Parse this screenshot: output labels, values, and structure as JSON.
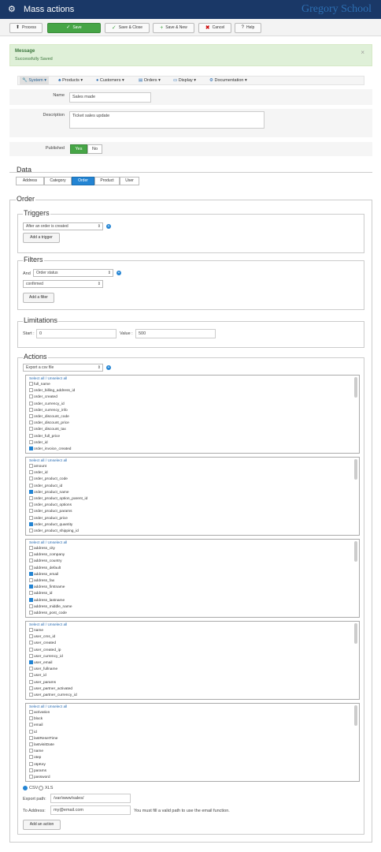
{
  "header": {
    "title": "Mass actions",
    "brand": "Gregory School",
    "gear_icon": "⚙"
  },
  "toolbar": [
    {
      "name": "process-button",
      "icon": "⬆",
      "label": "Process"
    },
    {
      "name": "save-button",
      "icon": "✓",
      "label": "Save"
    },
    {
      "name": "save-close-button",
      "icon": "✓",
      "label": "Save & Close"
    },
    {
      "name": "save-new-button",
      "icon": "+",
      "label": "Save & New"
    },
    {
      "name": "cancel-button",
      "icon": "✖",
      "label": "Cancel"
    },
    {
      "name": "help-button",
      "icon": "?",
      "label": "Help"
    }
  ],
  "message": {
    "heading": "Message",
    "text": "Successfully Saved",
    "close": "×"
  },
  "nav": [
    {
      "label": "System ▾"
    },
    {
      "label": "Products ▾"
    },
    {
      "label": "Customers ▾"
    },
    {
      "label": "Orders ▾"
    },
    {
      "label": "Display ▾"
    },
    {
      "label": "Documentation ▾"
    }
  ],
  "form": {
    "name_label": "Name",
    "name_value": "Sales made",
    "description_label": "Description",
    "description_value": "Ticket sales update",
    "published_label": "Published",
    "yes": "Yes",
    "no": "No"
  },
  "data_section": {
    "title": "Data",
    "tabs": [
      "Address",
      "Category",
      "Order",
      "Product",
      "User"
    ],
    "selected": "Order"
  },
  "order_section": {
    "title": "Order"
  },
  "triggers": {
    "title": "Triggers",
    "select": "After an order is created",
    "add": "Add a trigger"
  },
  "filters": {
    "title": "Filters",
    "and": "And",
    "select": "Order status",
    "value": "confirmed",
    "add": "Add a filter"
  },
  "limitations": {
    "title": "Limitations",
    "start_label": "Start :",
    "start": "0",
    "value_label": "Value :",
    "value": "500"
  },
  "actions": {
    "title": "Actions",
    "select": "Export a csv file",
    "select_all": "Select all / Unselect all",
    "lists": [
      {
        "items": [
          {
            "label": "full_name",
            "checked": false
          },
          {
            "label": "order_billing_address_id",
            "checked": false
          },
          {
            "label": "order_created",
            "checked": false
          },
          {
            "label": "order_currency_id",
            "checked": false
          },
          {
            "label": "order_currency_info",
            "checked": false
          },
          {
            "label": "order_discount_code",
            "checked": false
          },
          {
            "label": "order_discount_price",
            "checked": false
          },
          {
            "label": "order_discount_tax",
            "checked": false
          },
          {
            "label": "order_full_price",
            "checked": false
          },
          {
            "label": "order_id",
            "checked": false
          },
          {
            "label": "order_invoice_created",
            "checked": true
          }
        ]
      },
      {
        "items": [
          {
            "label": "amount",
            "checked": false
          },
          {
            "label": "order_id",
            "checked": false
          },
          {
            "label": "order_product_code",
            "checked": false
          },
          {
            "label": "order_product_id",
            "checked": false
          },
          {
            "label": "order_product_name",
            "checked": true
          },
          {
            "label": "order_product_option_parent_id",
            "checked": false
          },
          {
            "label": "order_product_options",
            "checked": false
          },
          {
            "label": "order_product_params",
            "checked": false
          },
          {
            "label": "order_product_price",
            "checked": false
          },
          {
            "label": "order_product_quantity",
            "checked": true
          },
          {
            "label": "order_product_shipping_id",
            "checked": false
          }
        ]
      },
      {
        "items": [
          {
            "label": "address_city",
            "checked": false
          },
          {
            "label": "address_company",
            "checked": false
          },
          {
            "label": "address_country",
            "checked": false
          },
          {
            "label": "address_default",
            "checked": false
          },
          {
            "label": "address_email",
            "checked": true
          },
          {
            "label": "address_fax",
            "checked": false
          },
          {
            "label": "address_firstname",
            "checked": true
          },
          {
            "label": "address_id",
            "checked": false
          },
          {
            "label": "address_lastname",
            "checked": true
          },
          {
            "label": "address_middle_name",
            "checked": false
          },
          {
            "label": "address_post_code",
            "checked": false
          }
        ]
      },
      {
        "items": [
          {
            "label": "name",
            "checked": false
          },
          {
            "label": "user_cms_id",
            "checked": false
          },
          {
            "label": "user_created",
            "checked": false
          },
          {
            "label": "user_created_ip",
            "checked": false
          },
          {
            "label": "user_currency_id",
            "checked": false
          },
          {
            "label": "user_email",
            "checked": true
          },
          {
            "label": "user_fullname",
            "checked": false
          },
          {
            "label": "user_id",
            "checked": false
          },
          {
            "label": "user_params",
            "checked": false
          },
          {
            "label": "user_partner_activated",
            "checked": false
          },
          {
            "label": "user_partner_currency_id",
            "checked": false
          }
        ]
      },
      {
        "items": [
          {
            "label": "activation",
            "checked": false
          },
          {
            "label": "block",
            "checked": false
          },
          {
            "label": "email",
            "checked": false
          },
          {
            "label": "id",
            "checked": false
          },
          {
            "label": "lastResetTime",
            "checked": false
          },
          {
            "label": "lastvisitDate",
            "checked": false
          },
          {
            "label": "name",
            "checked": false
          },
          {
            "label": "otep",
            "checked": false
          },
          {
            "label": "otpKey",
            "checked": false
          },
          {
            "label": "params",
            "checked": false
          },
          {
            "label": "password",
            "checked": false
          }
        ]
      }
    ],
    "csv": "CSV",
    "xls": "XLS",
    "export_path_label": "Export path:",
    "export_path": "/var/www/sales/",
    "to_address_label": "To Address:",
    "to_address": "my@email.com",
    "email_note": "You must fill a valid path to use the email function.",
    "add": "Add an action"
  }
}
